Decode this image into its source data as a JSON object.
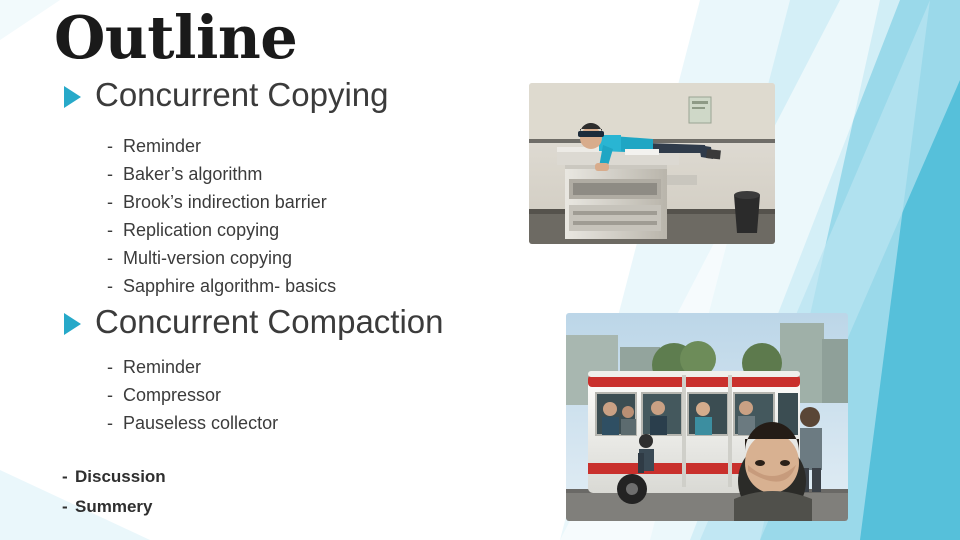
{
  "slide": {
    "title": "Outline",
    "sections": [
      {
        "heading": "Concurrent Copying",
        "items": [
          "Reminder",
          "Baker’s algorithm",
          "Brook’s indirection barrier",
          "Replication copying",
          "Multi-version copying",
          "Sapphire algorithm- basics"
        ]
      },
      {
        "heading": "Concurrent Compaction",
        "items": [
          "Reminder",
          "Compressor",
          "Pauseless collector"
        ]
      }
    ],
    "footer_items": [
      "Discussion",
      "Summery"
    ],
    "dash": "-",
    "images": [
      {
        "name": "photo-person-lying-on-copier",
        "caption": "person planking on an office photocopier"
      },
      {
        "name": "photo-people-hanging-on-bus",
        "caption": "people planking on a crowded bus"
      }
    ],
    "colors": {
      "accent": "#27a9c9",
      "text": "#3b3b3b",
      "title": "#1a1a1a",
      "band_light": "#d9eff6",
      "band_mid": "#9fd8ea",
      "band_dark": "#4cbcd8"
    }
  }
}
